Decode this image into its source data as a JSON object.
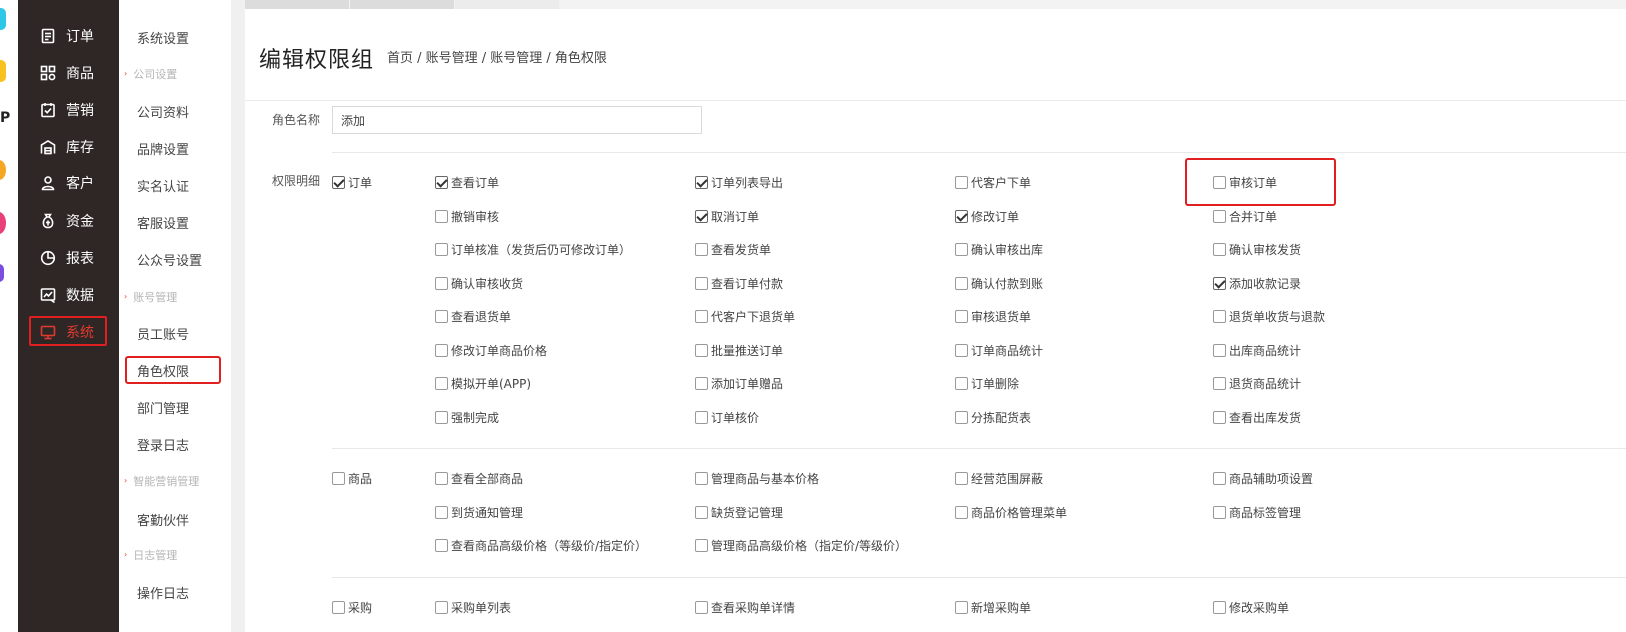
{
  "primary_nav": [
    {
      "icon": "order-icon",
      "label": "订单",
      "active": false
    },
    {
      "icon": "goods-icon",
      "label": "商品",
      "active": false
    },
    {
      "icon": "marketing-icon",
      "label": "营销",
      "active": false
    },
    {
      "icon": "warehouse-icon",
      "label": "库存",
      "active": false
    },
    {
      "icon": "customer-icon",
      "label": "客户",
      "active": false
    },
    {
      "icon": "funds-icon",
      "label": "资金",
      "active": false
    },
    {
      "icon": "report-icon",
      "label": "报表",
      "active": false
    },
    {
      "icon": "data-icon",
      "label": "数据",
      "active": false
    },
    {
      "icon": "system-icon",
      "label": "系统",
      "active": true
    }
  ],
  "secondary_nav": {
    "system_settings": "系统设置",
    "groups": [
      {
        "title": "公司设置",
        "items": [
          "公司资料",
          "品牌设置",
          "实名认证",
          "客服设置",
          "公众号设置"
        ]
      },
      {
        "title": "账号管理",
        "items": [
          "员工账号",
          "角色权限",
          "部门管理",
          "登录日志"
        ]
      },
      {
        "title": "智能营销管理",
        "items": [
          "客勤伙伴"
        ]
      },
      {
        "title": "日志管理",
        "items": [
          "操作日志"
        ]
      }
    ],
    "active": "角色权限"
  },
  "header": {
    "title": "编辑权限组",
    "breadcrumb": "首页 / 账号管理 / 账号管理 / 角色权限"
  },
  "form": {
    "role_name_label": "角色名称",
    "role_name_value": "添加",
    "permissions_label": "权限明细"
  },
  "permissions": {
    "order": {
      "label": "订单",
      "checked": true,
      "items": [
        {
          "label": "查看订单",
          "checked": true
        },
        {
          "label": "订单列表导出",
          "checked": true
        },
        {
          "label": "代客户下单",
          "checked": false
        },
        {
          "label": "审核订单",
          "checked": false
        },
        {
          "label": "撤销审核",
          "checked": false
        },
        {
          "label": "取消订单",
          "checked": true
        },
        {
          "label": "修改订单",
          "checked": true
        },
        {
          "label": "合并订单",
          "checked": false
        },
        {
          "label": "订单核准（发货后仍可修改订单）",
          "checked": false
        },
        {
          "label": "查看发货单",
          "checked": false
        },
        {
          "label": "确认审核出库",
          "checked": false
        },
        {
          "label": "确认审核发货",
          "checked": false
        },
        {
          "label": "确认审核收货",
          "checked": false
        },
        {
          "label": "查看订单付款",
          "checked": false
        },
        {
          "label": "确认付款到账",
          "checked": false
        },
        {
          "label": "添加收款记录",
          "checked": true
        },
        {
          "label": "查看退货单",
          "checked": false
        },
        {
          "label": "代客户下退货单",
          "checked": false
        },
        {
          "label": "审核退货单",
          "checked": false
        },
        {
          "label": "退货单收货与退款",
          "checked": false
        },
        {
          "label": "修改订单商品价格",
          "checked": false
        },
        {
          "label": "批量推送订单",
          "checked": false
        },
        {
          "label": "订单商品统计",
          "checked": false
        },
        {
          "label": "出库商品统计",
          "checked": false
        },
        {
          "label": "模拟开单(APP)",
          "checked": false
        },
        {
          "label": "添加订单赠品",
          "checked": false
        },
        {
          "label": "订单删除",
          "checked": false
        },
        {
          "label": "退货商品统计",
          "checked": false
        },
        {
          "label": "强制完成",
          "checked": false
        },
        {
          "label": "订单核价",
          "checked": false
        },
        {
          "label": "分拣配货表",
          "checked": false
        },
        {
          "label": "查看出库发货",
          "checked": false
        }
      ]
    },
    "goods": {
      "label": "商品",
      "checked": false,
      "items": [
        {
          "label": "查看全部商品",
          "checked": false
        },
        {
          "label": "管理商品与基本价格",
          "checked": false
        },
        {
          "label": "经营范围屏蔽",
          "checked": false
        },
        {
          "label": "商品辅助项设置",
          "checked": false
        },
        {
          "label": "到货通知管理",
          "checked": false
        },
        {
          "label": "缺货登记管理",
          "checked": false
        },
        {
          "label": "商品价格管理菜单",
          "checked": false
        },
        {
          "label": "商品标签管理",
          "checked": false
        },
        {
          "label": "查看商品高级价格（等级价/指定价）",
          "checked": false
        },
        {
          "label": "管理商品高级价格（指定价/等级价）",
          "checked": false
        }
      ]
    },
    "purchase": {
      "label": "采购",
      "checked": false,
      "items": [
        {
          "label": "采购单列表",
          "checked": false
        },
        {
          "label": "查看采购单详情",
          "checked": false
        },
        {
          "label": "新增采购单",
          "checked": false
        },
        {
          "label": "修改采购单",
          "checked": false
        }
      ]
    }
  },
  "colors": {
    "nav_bg": "#2f2726",
    "accent_red": "#e23a2f",
    "highlight_border": "#e02020"
  }
}
